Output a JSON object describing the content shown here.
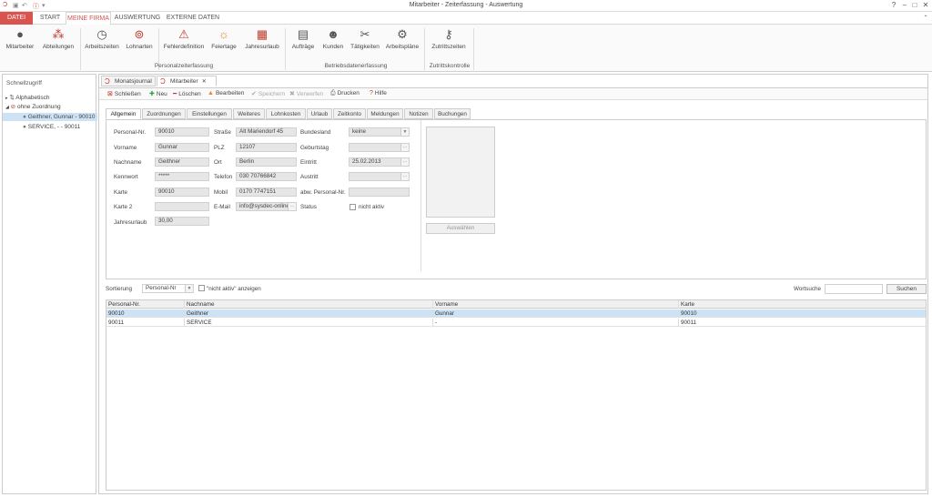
{
  "window": {
    "title": "Mitarbeiter - Zeiterfassung - Auswertung"
  },
  "ribbon_tabs": [
    {
      "label": "DATEI"
    },
    {
      "label": "START"
    },
    {
      "label": "MEINE FIRMA"
    },
    {
      "label": "AUSWERTUNG"
    },
    {
      "label": "EXTERNE DATEN"
    }
  ],
  "ribbon_buttons": [
    {
      "label": "Mitarbeiter",
      "icon": "person-icon"
    },
    {
      "label": "Abteilungen",
      "icon": "group-icon"
    },
    {
      "label": "Arbeitszeiten",
      "icon": "clock-icon"
    },
    {
      "label": "Lohnarten",
      "icon": "coins-icon"
    },
    {
      "label": "Fehlerdefinition",
      "icon": "warning-icon"
    },
    {
      "label": "Feiertage",
      "icon": "sun-icon"
    },
    {
      "label": "Jahresurlaub",
      "icon": "suitcase-icon"
    },
    {
      "label": "Aufträge",
      "icon": "clipboard-icon"
    },
    {
      "label": "Kunden",
      "icon": "customer-icon"
    },
    {
      "label": "Tätigkeiten",
      "icon": "tools-icon"
    },
    {
      "label": "Arbeitspläne",
      "icon": "plan-icon"
    },
    {
      "label": "Zutrittszeiten",
      "icon": "key-person-icon"
    }
  ],
  "ribbon_groups": [
    {
      "label": "Personalzeiterfassung"
    },
    {
      "label": "Betriebsdatenerfassung"
    },
    {
      "label": "Zutrittskontrolle"
    }
  ],
  "sidebar": {
    "title": "Schnellzugriff",
    "items": [
      {
        "label": "Alphabetisch"
      },
      {
        "label": "ohne Zuordnung"
      },
      {
        "label": "Geithner, Gunnar - 90010"
      },
      {
        "label": "SERVICE, - - 90011"
      }
    ]
  },
  "doc_tabs": [
    {
      "label": "Monatsjournal"
    },
    {
      "label": "Mitarbeiter"
    }
  ],
  "toolbar": {
    "close": "Schließen",
    "new": "Neu",
    "delete": "Löschen",
    "edit": "Bearbeiten",
    "save": "Speichern",
    "discard": "Verwerfen",
    "print": "Drucken",
    "help": "Hilfe"
  },
  "sub_tabs": [
    {
      "label": "Allgemein"
    },
    {
      "label": "Zuordnungen"
    },
    {
      "label": "Einstellungen"
    },
    {
      "label": "Weiteres"
    },
    {
      "label": "Lohnkosten"
    },
    {
      "label": "Urlaub"
    },
    {
      "label": "Zeitkonto"
    },
    {
      "label": "Meldungen"
    },
    {
      "label": "Notizen"
    },
    {
      "label": "Buchungen"
    }
  ],
  "form": {
    "personalnr": {
      "label": "Personal-Nr.",
      "value": "90010"
    },
    "vorname": {
      "label": "Vorname",
      "value": "Gunnar"
    },
    "nachname": {
      "label": "Nachname",
      "value": "Geithner"
    },
    "kennwort": {
      "label": "Kennwort",
      "value": "*****"
    },
    "karte": {
      "label": "Karte",
      "value": "90010"
    },
    "karte2": {
      "label": "Karte 2",
      "value": ""
    },
    "jahresurlaub": {
      "label": "Jahresurlaub",
      "value": "30,00"
    },
    "strasse": {
      "label": "Straße",
      "value": "Alt Mariendorf 45"
    },
    "plz": {
      "label": "PLZ",
      "value": "12107"
    },
    "ort": {
      "label": "Ort",
      "value": "Berlin"
    },
    "telefon": {
      "label": "Telefon",
      "value": "030 70766842"
    },
    "mobil": {
      "label": "Mobil",
      "value": "0170 7747151"
    },
    "email": {
      "label": "E-Mail",
      "value": "info@sysdec-online"
    },
    "bundesland": {
      "label": "Bundesland",
      "value": "keine"
    },
    "geburtstag": {
      "label": "Geburtstag",
      "value": ""
    },
    "eintritt": {
      "label": "Eintritt",
      "value": "25.02.2013"
    },
    "austritt": {
      "label": "Austritt",
      "value": ""
    },
    "abw_personalnr": {
      "label": "abw. Personal-Nr.",
      "value": ""
    },
    "status": {
      "label": "Status",
      "checkbox_label": "nicht aktiv",
      "checked": false
    },
    "photo_button": "Auswählen"
  },
  "sortbar": {
    "label": "Sortierung",
    "value": "Personal-Nr",
    "show_inactive": "\"nicht aktiv\" anzeigen",
    "search_label": "Wortsuche",
    "search_value": "",
    "search_button": "Suchen"
  },
  "grid": {
    "columns": [
      "Personal-Nr.",
      "Nachname",
      "Vorname",
      "Karte"
    ],
    "rows": [
      [
        "90010",
        "Geithner",
        "Gunnar",
        "90010"
      ],
      [
        "90011",
        "SERVICE",
        "-",
        "90011"
      ]
    ]
  },
  "colors": {
    "accent": "#d9534f",
    "selection": "#cde3f5"
  }
}
